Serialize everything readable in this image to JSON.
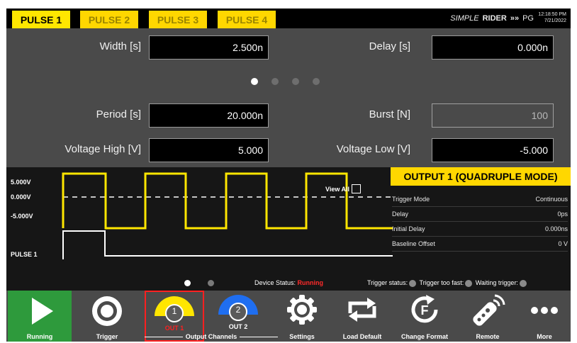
{
  "tabs": [
    "PULSE 1",
    "PULSE 2",
    "PULSE 3",
    "PULSE 4"
  ],
  "brand": {
    "simple": "SIMPLE",
    "rider": "RIDER",
    "arrows": "»»",
    "pg": "PG"
  },
  "clock": {
    "time": "12:18:50 PM",
    "date": "7/21/2022"
  },
  "params": {
    "width": {
      "label": "Width [s]",
      "value": "2.500",
      "unit": "n"
    },
    "delay": {
      "label": "Delay [s]",
      "value": "0.000",
      "unit": "n"
    },
    "period": {
      "label": "Period [s]",
      "value": "20.000",
      "unit": "n"
    },
    "burst": {
      "label": "Burst [N]",
      "value": "100"
    },
    "vhigh": {
      "label": "Voltage High [V]",
      "value": "5.000"
    },
    "vlow": {
      "label": "Voltage Low [V]",
      "value": "-5.000"
    }
  },
  "page_dots": {
    "count": 4,
    "active": 0
  },
  "waveform": {
    "labels": {
      "high": "5.000V",
      "zero": "0.000V",
      "low": "-5.000V",
      "pulse": "PULSE 1"
    },
    "view_all": "View All",
    "colors": {
      "signal": "#ffe600",
      "pulse": "#ffffff"
    }
  },
  "output": {
    "title": "OUTPUT 1 (QUADRUPLE MODE)",
    "rows": [
      {
        "label": "Trigger Mode",
        "value": "Continuous"
      },
      {
        "label": "Delay",
        "value": "0ps"
      },
      {
        "label": "Initial Delay",
        "value": "0.000ns"
      },
      {
        "label": "Baseline Offset",
        "value": "0 V"
      }
    ]
  },
  "status": {
    "device_label": "Device Status:",
    "device_value": "Running",
    "trigger_status": "Trigger status:",
    "trigger_too_fast": "Trigger too fast:",
    "waiting_trigger": "Waiting trigger:"
  },
  "toolbar": {
    "running": "Running",
    "trigger": "Trigger",
    "out1_num": "1",
    "out1": "OUT 1",
    "out2_num": "2",
    "out2": "OUT 2",
    "output_channels": "Output Channels",
    "settings": "Settings",
    "load_default": "Load Default",
    "change_format": "Change Format",
    "remote": "Remote",
    "more": "More",
    "icons": [
      "play-icon",
      "target-icon",
      "out1-gauge-icon",
      "out2-gauge-icon",
      "gear-icon",
      "refresh-icon",
      "format-icon",
      "remote-icon",
      "more-icon"
    ]
  }
}
